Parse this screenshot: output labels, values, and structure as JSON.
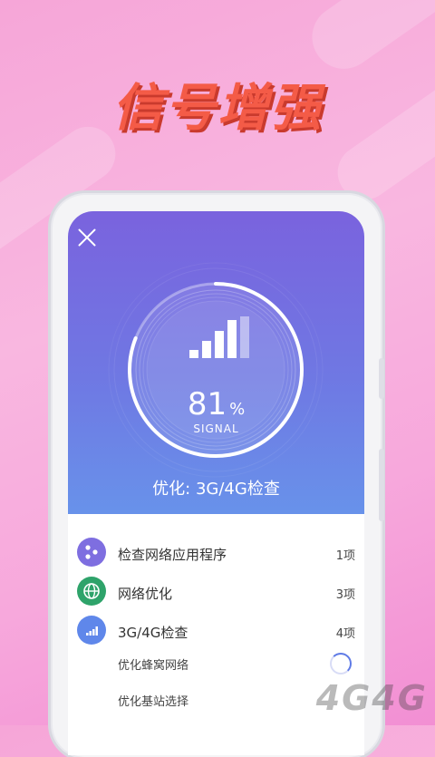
{
  "hero_title": "信号增强",
  "close_label": "",
  "gauge": {
    "percent_value": "81",
    "percent_sign": "%",
    "percent_fraction": 0.81,
    "caption": "SIGNAL"
  },
  "status_text": "优化: 3G/4G检查",
  "items": [
    {
      "label": "检查网络应用程序",
      "count": "1项",
      "icon": "dots-icon",
      "color": "#7e6ee0"
    },
    {
      "label": "网络优化",
      "count": "3项",
      "icon": "globe-icon",
      "color": "#2ea36a"
    },
    {
      "label": "3G/4G检查",
      "count": "4项",
      "icon": "signal-icon",
      "color": "#5f87ea"
    }
  ],
  "subitems": [
    {
      "label": "优化蜂窝网络"
    },
    {
      "label": "优化基站选择"
    }
  ],
  "watermark": "4G4G"
}
